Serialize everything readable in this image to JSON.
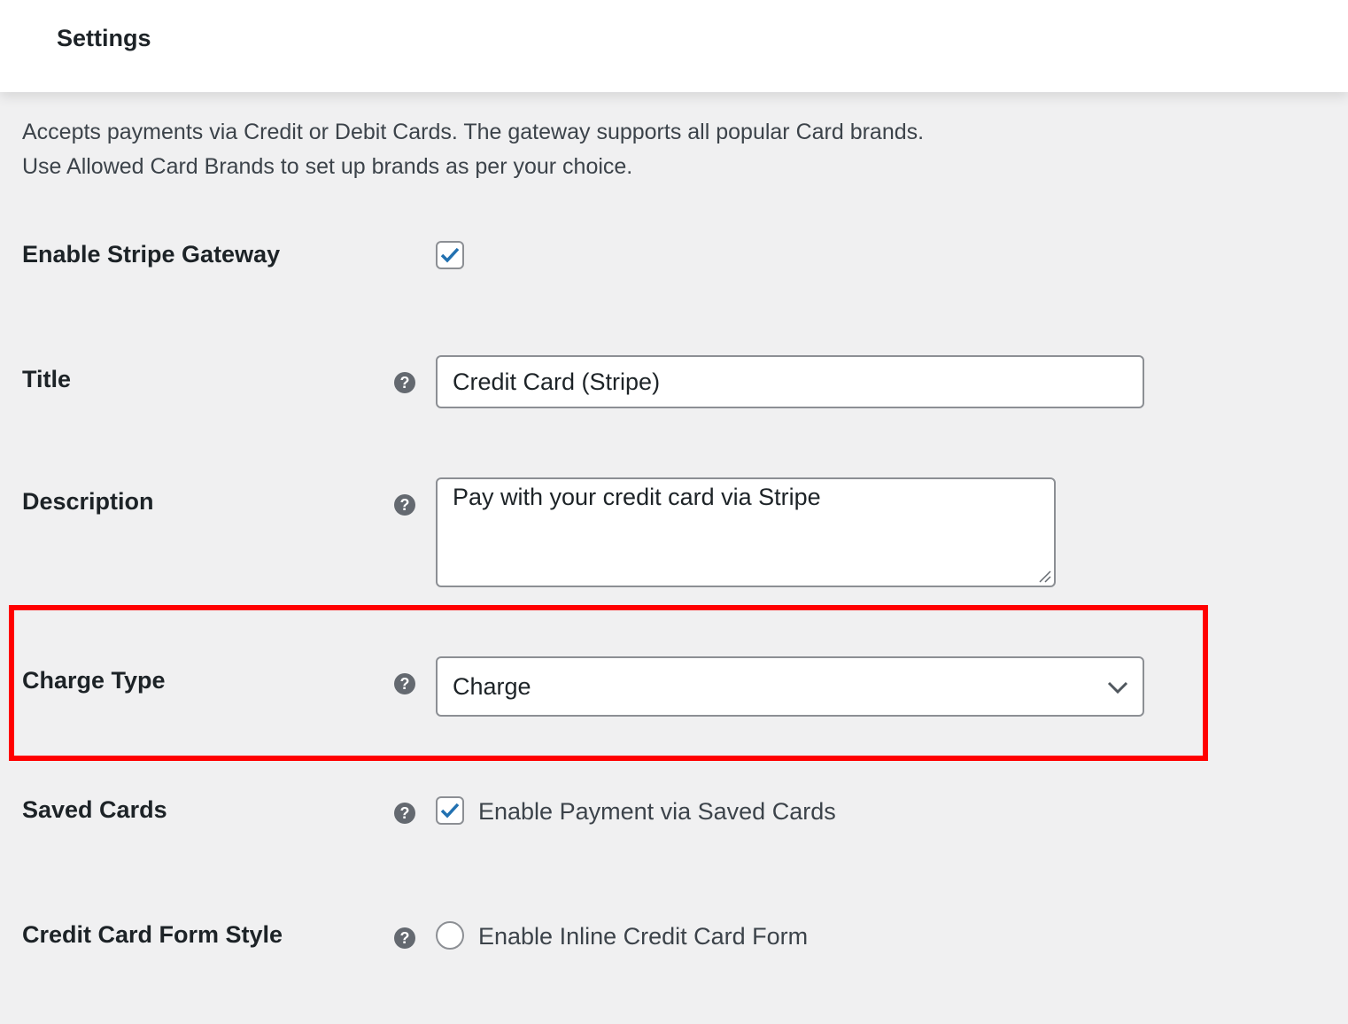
{
  "header": {
    "title": "Settings"
  },
  "description": [
    "Accepts payments via Credit or Debit Cards. The gateway supports all popular Card brands.",
    "Use Allowed Card Brands to set up brands as per your choice."
  ],
  "fields": {
    "enable": {
      "label": "Enable Stripe Gateway",
      "checked": true
    },
    "title": {
      "label": "Title",
      "value": "Credit Card (Stripe)"
    },
    "description": {
      "label": "Description",
      "value": "Pay with your credit card via Stripe"
    },
    "charge_type": {
      "label": "Charge Type",
      "value": "Charge"
    },
    "saved_cards": {
      "label": "Saved Cards",
      "option": "Enable Payment via Saved Cards",
      "checked": true
    },
    "form_style": {
      "label": "Credit Card Form Style",
      "option": "Enable Inline Credit Card Form",
      "checked": false
    }
  },
  "help_glyph": "?",
  "colors": {
    "accent": "#2271b1",
    "highlight": "#ff0000"
  }
}
